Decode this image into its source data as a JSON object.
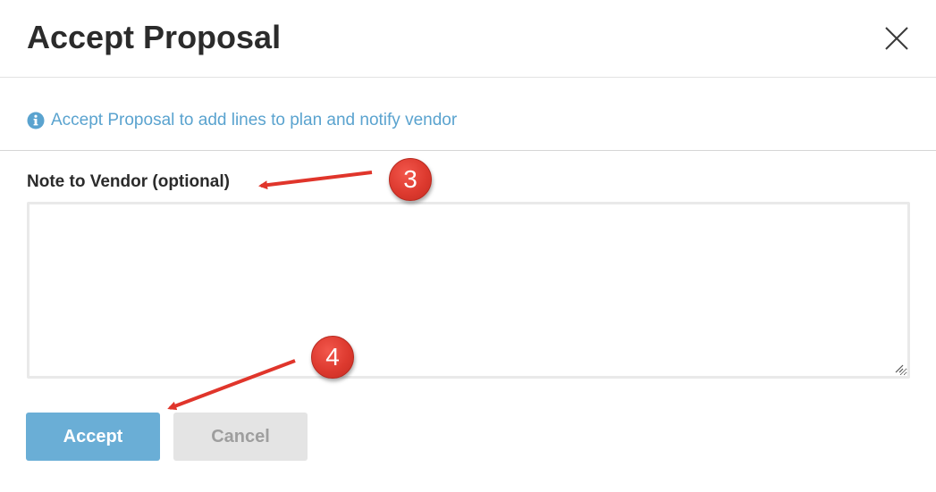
{
  "dialog": {
    "title": "Accept Proposal",
    "close_icon": "close-icon",
    "info_icon": "info-circle-icon",
    "info_text": "Accept Proposal to add lines to plan and notify vendor",
    "info_color": "#5aa3cf",
    "note_label": "Note to Vendor (optional)",
    "note_value": "",
    "accept_label": "Accept",
    "cancel_label": "Cancel",
    "accept_color": "#6aaed6",
    "cancel_color": "#e4e4e4"
  },
  "annotations": {
    "step_3": "3",
    "step_4": "4",
    "arrow_color": "#e0352b"
  }
}
